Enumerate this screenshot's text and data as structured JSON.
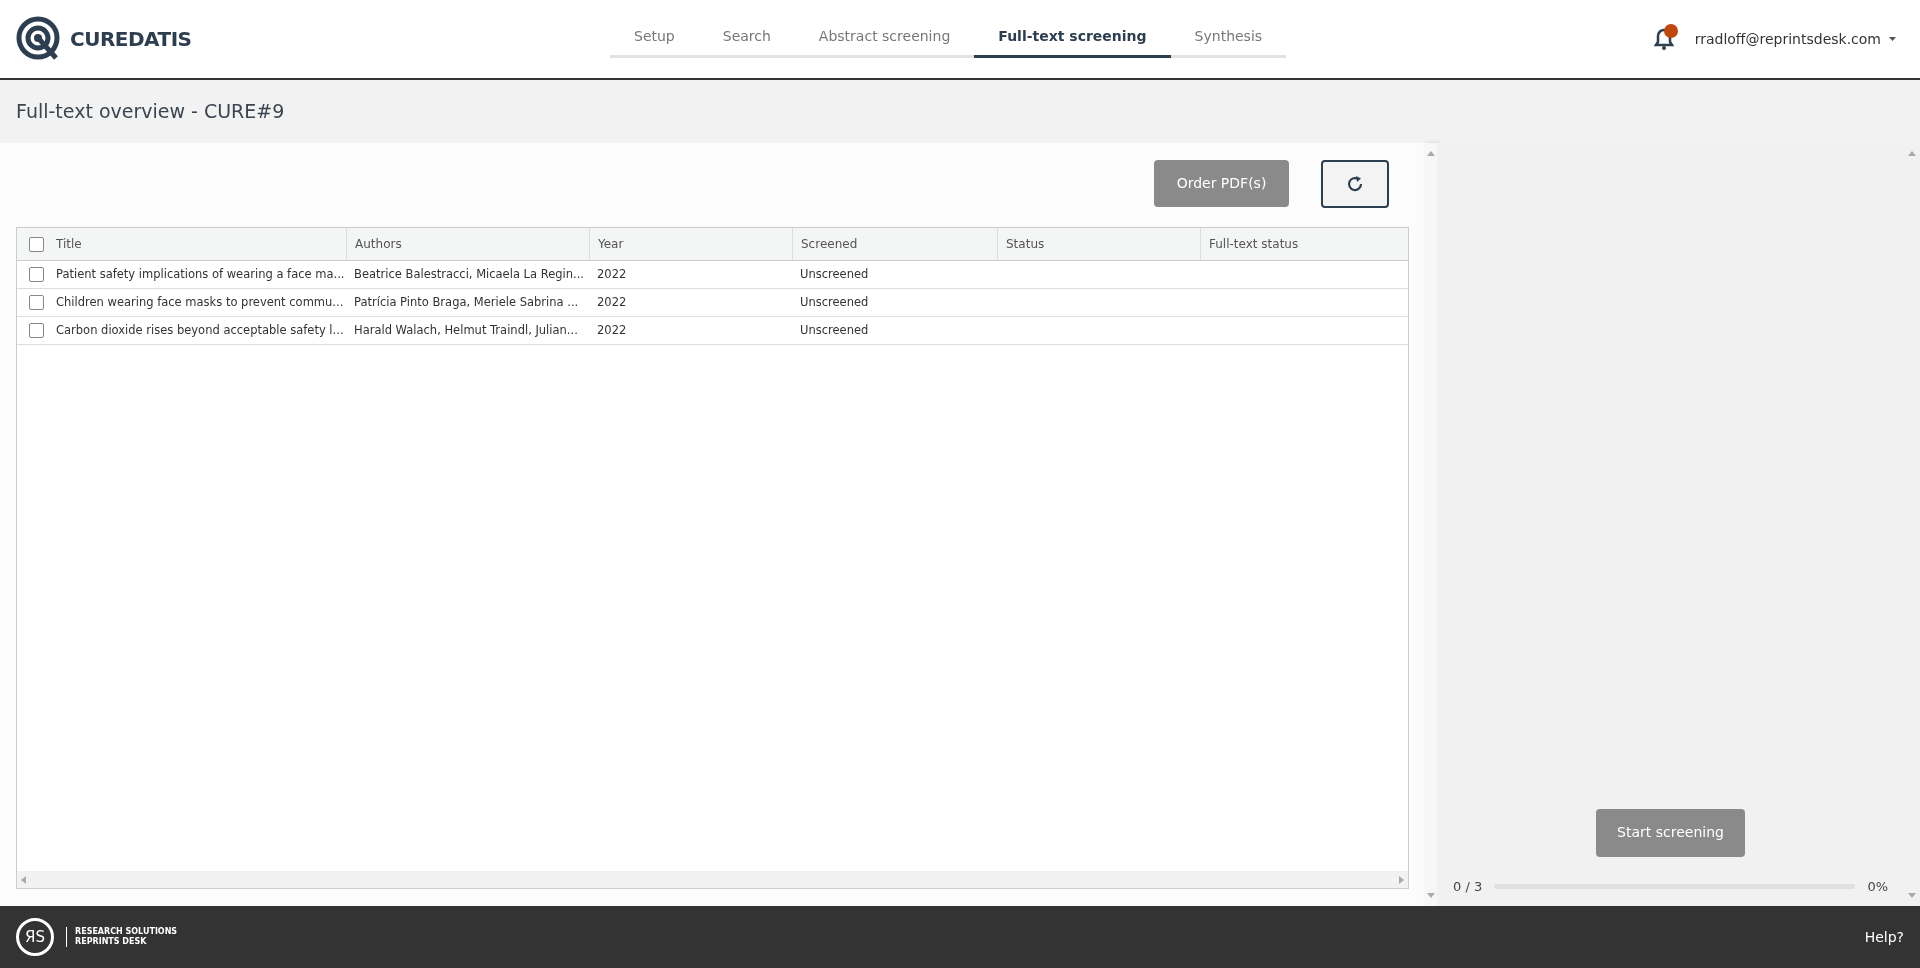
{
  "header": {
    "logo_text": "CUREDATIS",
    "tabs": [
      {
        "label": "Setup",
        "selected": false
      },
      {
        "label": "Search",
        "selected": false
      },
      {
        "label": "Abstract screening",
        "selected": false
      },
      {
        "label": "Full-text screening",
        "selected": true
      },
      {
        "label": "Synthesis",
        "selected": false
      }
    ],
    "notification_badge": true,
    "user": "rradloff@reprintsdesk.com"
  },
  "page_title": "Full-text overview - CURE#9",
  "toolbar": {
    "order_button": "Order PDF(s)"
  },
  "table": {
    "all_checked": false,
    "columns": [
      "Title",
      "Authors",
      "Year",
      "Screened",
      "Status",
      "Full-text status"
    ],
    "rows": [
      {
        "checked": false,
        "cells": [
          "Patient safety implications of wearing a face ma...",
          "Beatrice Balestracci, Micaela La Regin...",
          "2022",
          "Unscreened",
          "",
          ""
        ]
      },
      {
        "checked": false,
        "cells": [
          "Children wearing face masks to prevent commu...",
          "Patrícia Pinto Braga, Meriele Sabrina ...",
          "2022",
          "Unscreened",
          "",
          ""
        ]
      },
      {
        "checked": false,
        "cells": [
          "Carbon dioxide rises beyond acceptable safety l...",
          "Harald Walach, Helmut Traindl, Julian...",
          "2022",
          "Unscreened",
          "",
          ""
        ]
      }
    ]
  },
  "side_panel": {
    "start_button": "Start screening",
    "progress_count": "0 / 3",
    "level": 0,
    "progress_percent": "0%"
  },
  "footer": {
    "logo_mark": "ЯS",
    "logo_lines": [
      "RESEARCH SOLUTIONS",
      "REPRINTS DESK"
    ],
    "help": "Help?"
  }
}
